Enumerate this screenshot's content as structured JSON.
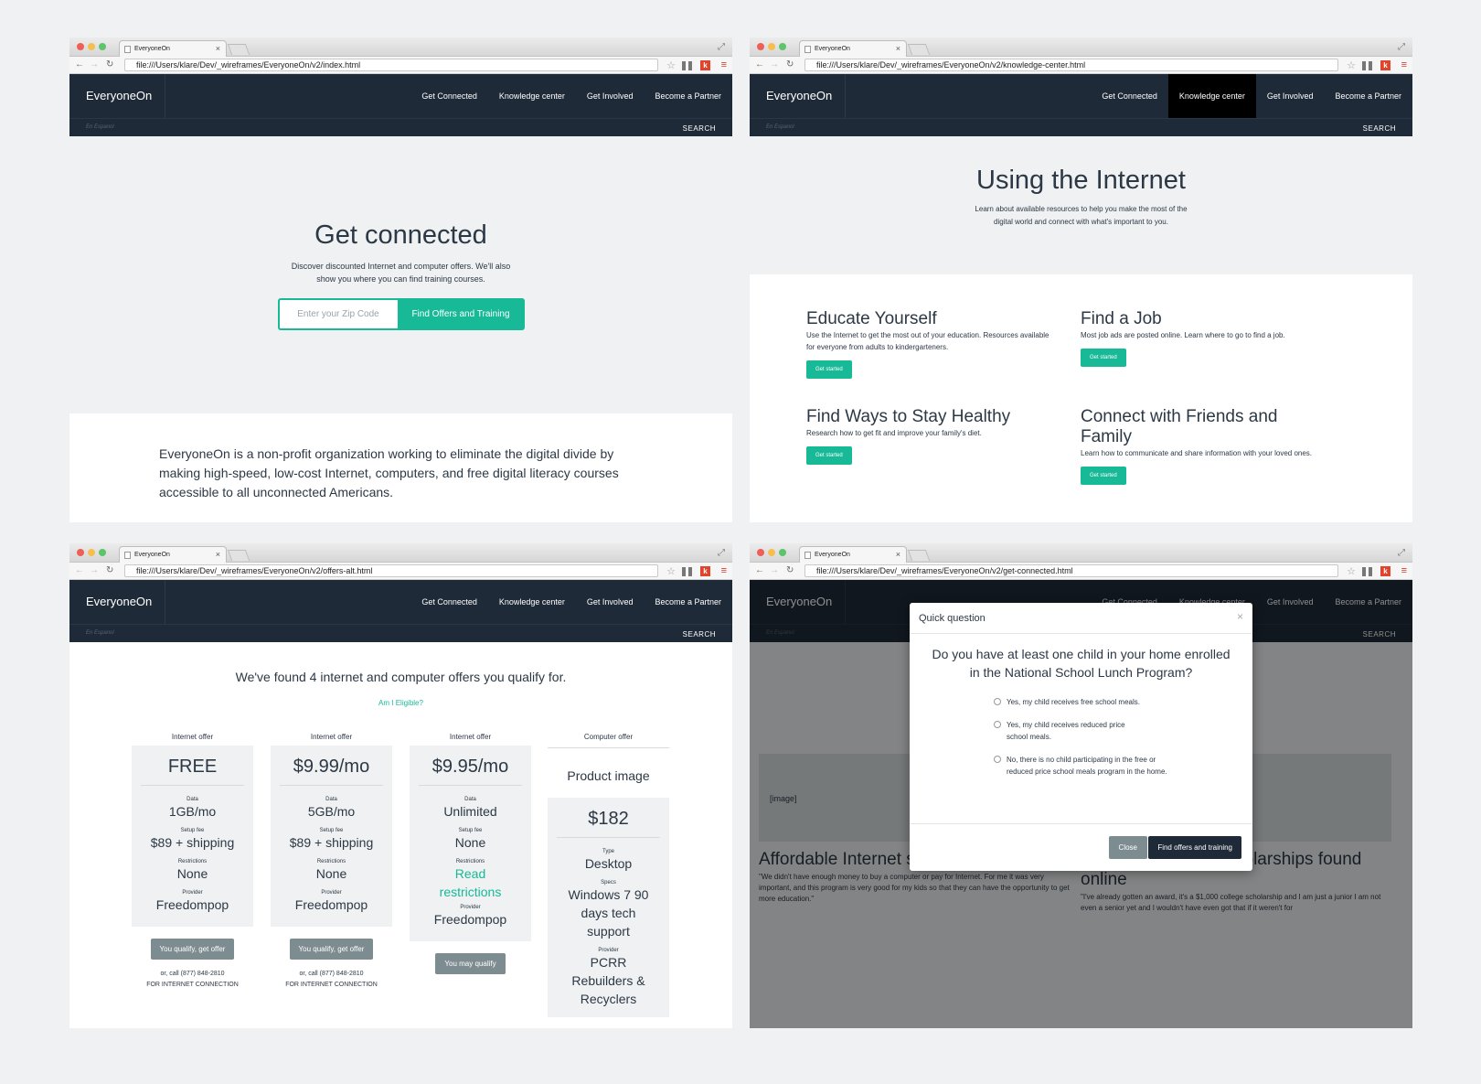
{
  "browser": {
    "tab_title": "EveryoneOn",
    "windows": [
      {
        "url": "file:///Users/klare/Dev/_wireframes/EveryoneOn/v2/index.html"
      },
      {
        "url": "file:///Users/klare/Dev/_wireframes/EveryoneOn/v2/knowledge-center.html"
      },
      {
        "url": "file:///Users/klare/Dev/_wireframes/EveryoneOn/v2/offers-alt.html"
      },
      {
        "url": "file:///Users/klare/Dev/_wireframes/EveryoneOn/v2/get-connected.html"
      }
    ],
    "ext_k": "k"
  },
  "site": {
    "brand": "EveryoneOn",
    "nav": [
      "Get Connected",
      "Knowledge center",
      "Get Involved",
      "Become a Partner"
    ],
    "espanol": "En Espanol",
    "search": "SEARCH"
  },
  "home": {
    "title": "Get connected",
    "desc": "Discover discounted Internet and computer offers. We'll also show you where you can find training courses.",
    "zip_placeholder": "Enter your Zip Code",
    "find_button": "Find Offers and Training",
    "about": "EveryoneOn is a non-profit organization working to eliminate the digital divide by making high-speed, low-cost Internet, computers, and free digital literacy courses accessible to all unconnected Americans."
  },
  "knowledge": {
    "title": "Using the Internet",
    "desc": "Learn about available resources to help you make the most of the digital world and connect with what's important to you.",
    "button": "Get started",
    "items": [
      {
        "title": "Educate Yourself",
        "desc": "Use the Internet to get the most out of your education. Resources available for everyone from adults to kindergarteners."
      },
      {
        "title": "Find a Job",
        "desc": "Most job ads are posted online. Learn where to go to find a job."
      },
      {
        "title": "Find Ways to Stay Healthy",
        "desc": "Research how to get fit and improve your family's diet."
      },
      {
        "title": "Connect with Friends and Family",
        "desc": "Learn how to communicate and share information with your loved ones."
      }
    ]
  },
  "offers": {
    "heading": "We've found 4 internet and computer offers you qualify for.",
    "eligible": "Am I Eligible?",
    "labels": {
      "data": "Data",
      "setup": "Setup fee",
      "restrictions": "Restrictions",
      "provider": "Provider",
      "type": "Type",
      "specs": "Specs"
    },
    "cards": [
      {
        "head": "Internet offer",
        "price": "FREE",
        "data": "1GB/mo",
        "setup": "$89 + shipping",
        "restrictions": "None",
        "provider": "Freedompop",
        "button": "You qualify, get offer",
        "phone": "or, call (877) 848-2810",
        "conn": "FOR INTERNET CONNECTION"
      },
      {
        "head": "Internet offer",
        "price": "$9.99/mo",
        "data": "5GB/mo",
        "setup": "$89 + shipping",
        "restrictions": "None",
        "provider": "Freedompop",
        "button": "You qualify, get offer",
        "phone": "or, call (877) 848-2810",
        "conn": "FOR INTERNET CONNECTION"
      },
      {
        "head": "Internet offer",
        "price": "$9.95/mo",
        "data": "Unlimited",
        "setup": "None",
        "restrictions": "Read restrictions",
        "provider": "Freedompop",
        "button": "You may qualify"
      },
      {
        "head": "Computer offer",
        "image": "Product image",
        "price": "$182",
        "type": "Desktop",
        "specs": "Windows 7 90 days tech support",
        "provider": "PCRR Rebuilders & Recyclers"
      }
    ]
  },
  "modal": {
    "title": "Quick question",
    "close_x": "×",
    "question": "Do you have at least one child in your home enrolled in the National School Lunch Program?",
    "options": [
      "Yes, my child receives free school meals.",
      "Yes, my child receives reduced price school meals.",
      "No, there is no child participating in the free or reduced price school meals program in the home."
    ],
    "close_button": "Close",
    "find_button": "Find offers and training"
  },
  "background": {
    "image_label": "[image]",
    "stories": [
      {
        "title": "Affordable Internet service",
        "quote": "\"We didn't have enough money to buy a computer or pay for Internet. For me it was very important, and this program is very good for my kids so that they can have the opportunity to get more education.\""
      },
      {
        "title": "$1,000 in college scholarships found online",
        "quote": "\"I've already gotten an award, it's a $1,000 college scholarship and I am just a junior I am not even a senior yet and I wouldn't have even got that if it weren't for"
      }
    ]
  },
  "colors": {
    "accent": "#17b996",
    "navbar": "#1f2a38",
    "hero_bg": "#eff1f2"
  }
}
